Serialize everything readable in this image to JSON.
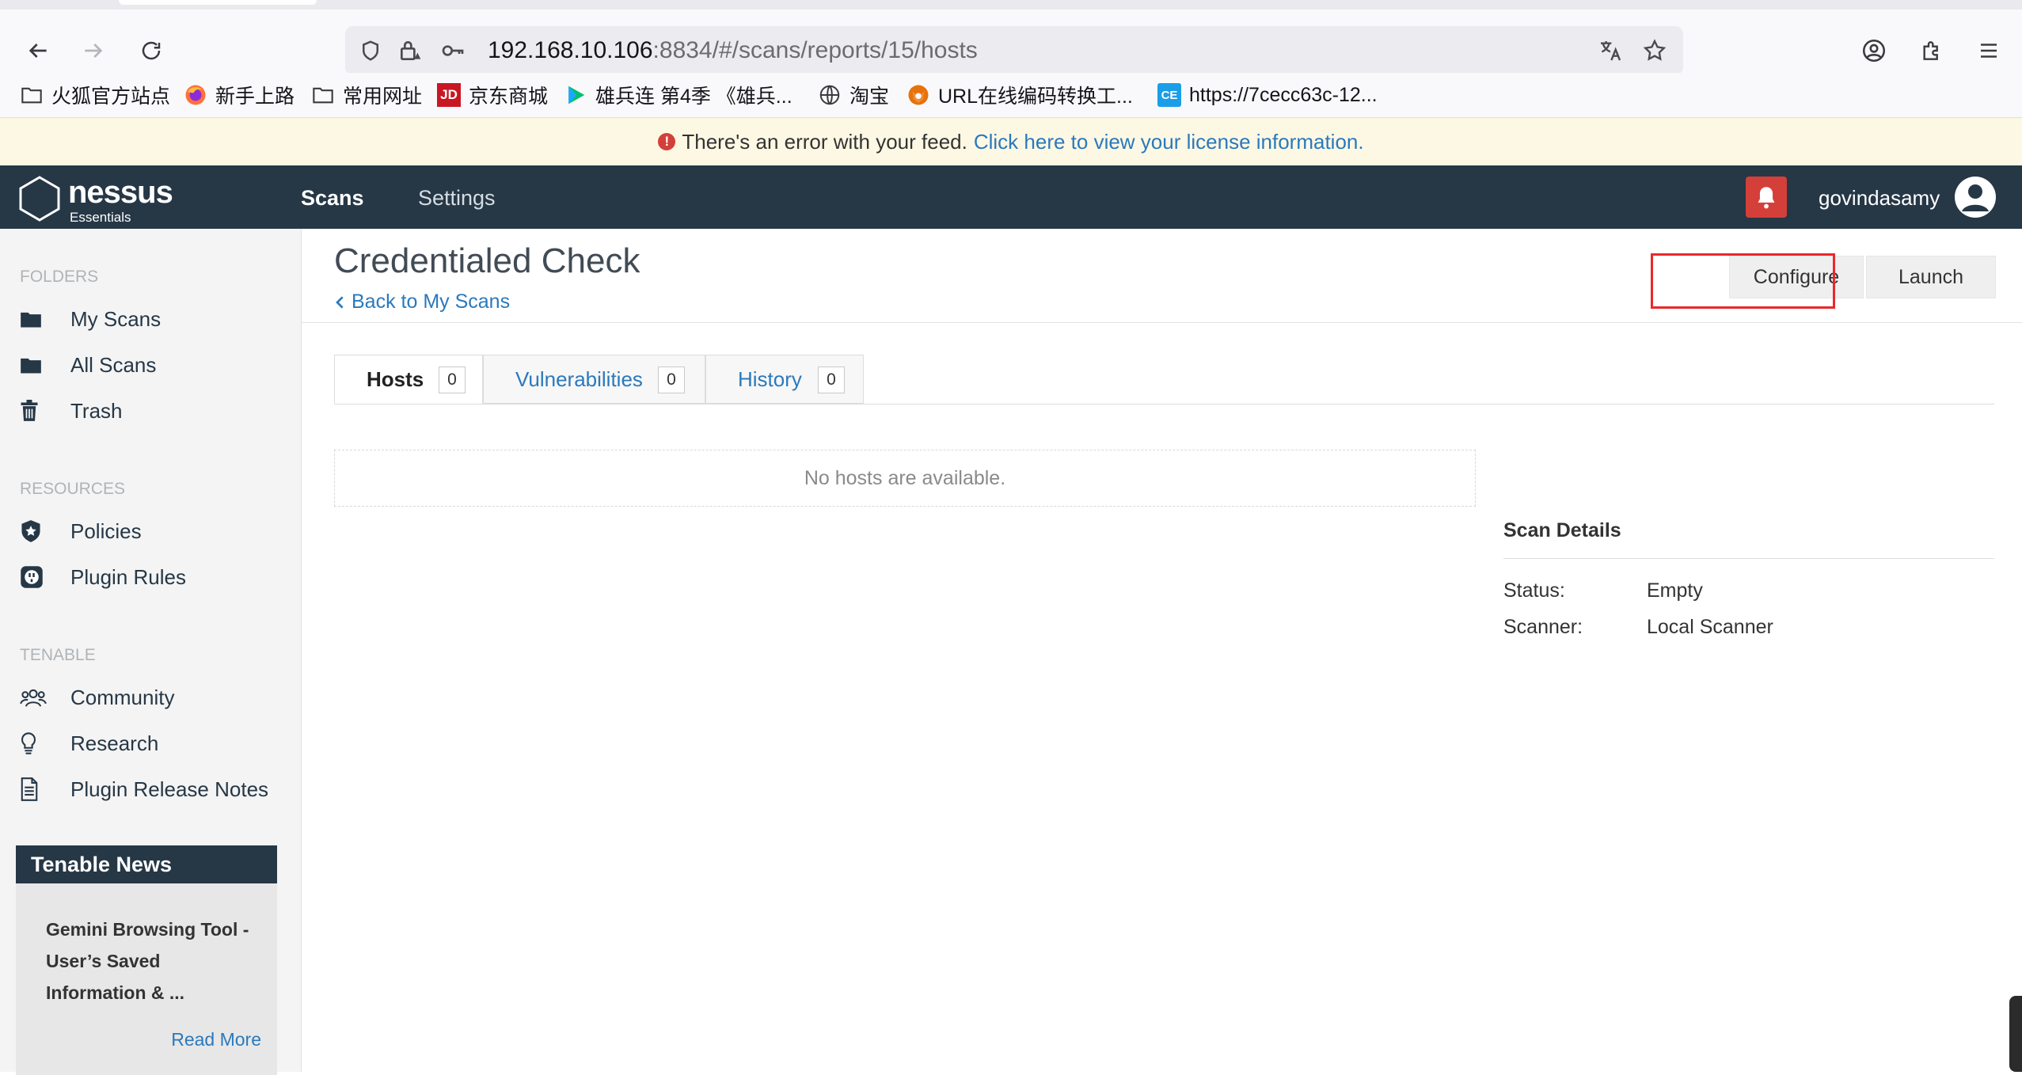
{
  "browser": {
    "url_host": "192.168.10.106",
    "url_rest": ":8834/#/scans/reports/15/hosts",
    "bookmarks": [
      {
        "label": "火狐官方站点",
        "icon": "folder-icon"
      },
      {
        "label": "新手上路",
        "icon": "firefox-icon"
      },
      {
        "label": "常用网址",
        "icon": "folder-icon"
      },
      {
        "label": "京东商城",
        "icon": "jd-icon"
      },
      {
        "label": "雄兵连 第4季 《雄兵...",
        "icon": "video-play-icon"
      },
      {
        "label": "淘宝",
        "icon": "globe-icon"
      },
      {
        "label": "URL在线编码转换工...",
        "icon": "fox-icon"
      },
      {
        "label": "https://7cecc63c-12...",
        "icon": "ce-icon"
      }
    ],
    "jd_badge": "JD",
    "ce_badge": "CE"
  },
  "banner": {
    "icon": "!",
    "message": "There's an error with your feed.",
    "link": "Click here to view your license information."
  },
  "header": {
    "logo_word": "nessus",
    "logo_sub": "Essentials",
    "nav": [
      {
        "label": "Scans",
        "active": true
      },
      {
        "label": "Settings",
        "active": false
      }
    ],
    "username": "govindasamy"
  },
  "sidebar": {
    "folders_heading": "FOLDERS",
    "folders": [
      {
        "label": "My Scans",
        "icon": "folder-icon"
      },
      {
        "label": "All Scans",
        "icon": "folder-icon"
      },
      {
        "label": "Trash",
        "icon": "trash-icon"
      }
    ],
    "resources_heading": "RESOURCES",
    "resources": [
      {
        "label": "Policies",
        "icon": "shield-icon"
      },
      {
        "label": "Plugin Rules",
        "icon": "plug-icon"
      }
    ],
    "tenable_heading": "TENABLE",
    "tenable": [
      {
        "label": "Community",
        "icon": "people-icon"
      },
      {
        "label": "Research",
        "icon": "lightbulb-icon"
      },
      {
        "label": "Plugin Release Notes",
        "icon": "document-icon"
      }
    ],
    "news": {
      "heading": "Tenable News",
      "title": "Gemini Browsing Tool - User’s Saved Information & ...",
      "read_more": "Read More"
    }
  },
  "main": {
    "title": "Credentialed Check",
    "back_link": "Back to My Scans",
    "configure": "Configure",
    "launch": "Launch",
    "tabs": [
      {
        "label": "Hosts",
        "count": "0",
        "active": true
      },
      {
        "label": "Vulnerabilities",
        "count": "0",
        "active": false
      },
      {
        "label": "History",
        "count": "0",
        "active": false
      }
    ],
    "empty_message": "No hosts are available.",
    "scan_details": {
      "title": "Scan Details",
      "rows": [
        {
          "label": "Status:",
          "value": "Empty"
        },
        {
          "label": "Scanner:",
          "value": "Local Scanner"
        }
      ]
    }
  },
  "colors": {
    "header_bg": "#263746",
    "link": "#2a79bd",
    "alert_red": "#d43f3a",
    "banner_bg": "#fdf8e4"
  }
}
